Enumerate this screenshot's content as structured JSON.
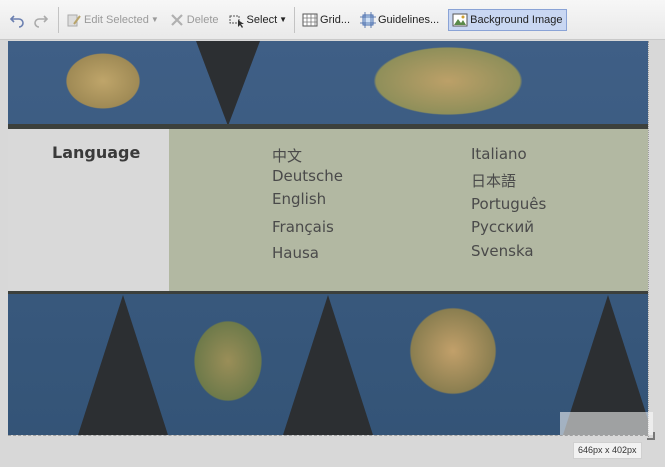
{
  "toolbar": {
    "undo_icon": "undo-icon",
    "redo_icon": "redo-icon",
    "edit_selected": "Edit Selected",
    "delete": "Delete",
    "select": "Select",
    "grid": "Grid...",
    "guidelines": "Guidelines...",
    "background_image": "Background Image"
  },
  "content": {
    "language_title": "Language",
    "languages_col1": [
      "中文",
      "Deutsche",
      "English",
      "Français",
      "Hausa"
    ],
    "languages_col2": [
      "Italiano",
      "日本語",
      "Português",
      "Русский",
      "Svenska"
    ]
  },
  "canvas": {
    "size_label": "646px x 402px"
  },
  "colors": {
    "panel": "#b2b8a2",
    "label_box": "#d9d9d9",
    "active_button": "#c9d7f2"
  }
}
